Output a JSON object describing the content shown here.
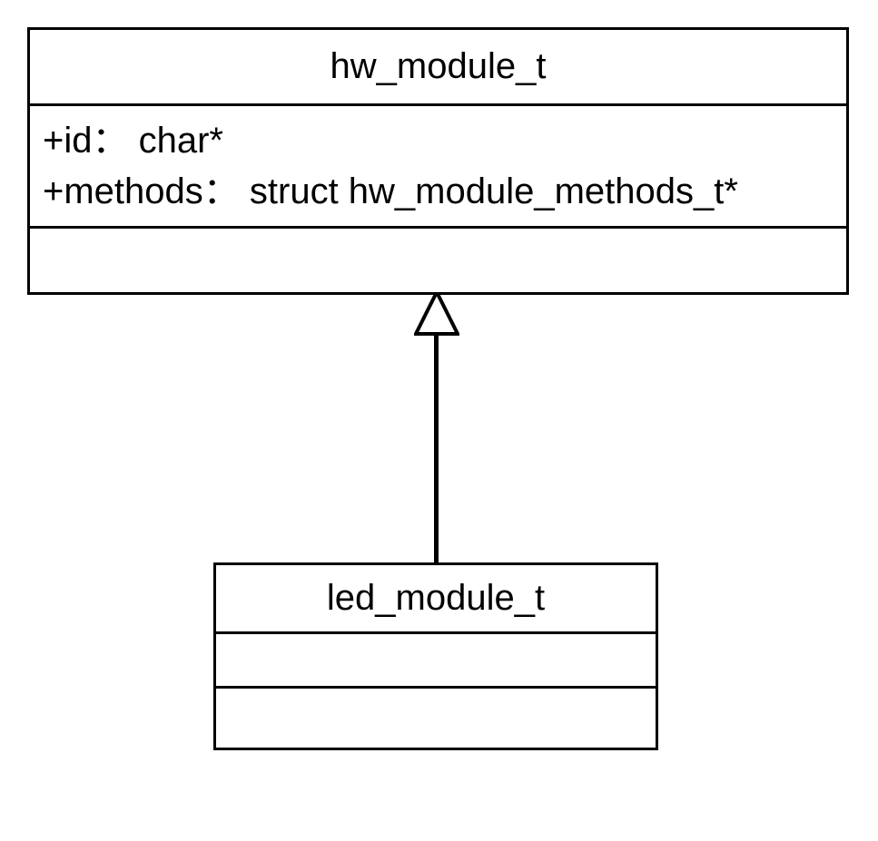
{
  "diagram": {
    "type": "uml-class-diagram",
    "relationship": "inheritance",
    "parent_class": {
      "name": "hw_module_t",
      "attributes": [
        "+id：  char*",
        "+methods：  struct hw_module_methods_t*"
      ],
      "methods": []
    },
    "child_class": {
      "name": "led_module_t",
      "attributes": [],
      "methods": []
    }
  }
}
